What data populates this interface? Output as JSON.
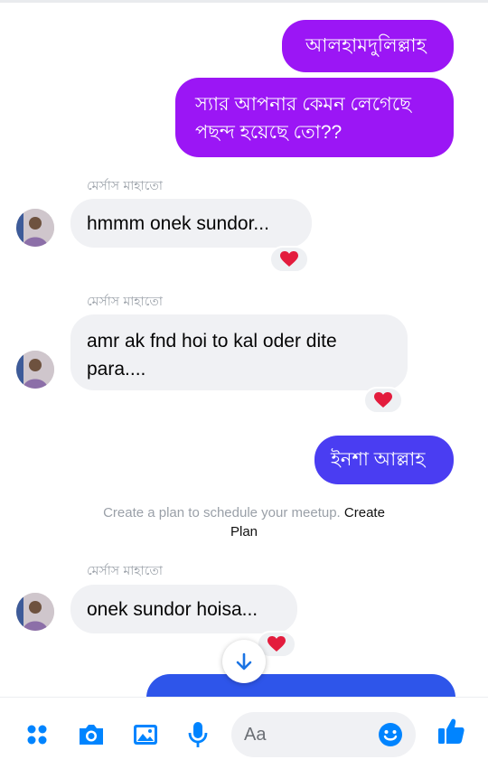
{
  "messages": {
    "out1": "আলহামদুলিল্লাহ",
    "out2_line1": "স্যার আপনার কেমন লেগেছে",
    "out2_line2": "পছন্দ হয়েছে তো??",
    "sender_name": "মের্সাস মাহাতো",
    "in1": "hmmm onek sundor...",
    "in2_line1": "amr ak fnd hoi to kal oder dite",
    "in2_line2": "para....",
    "out3": "ইনশা আল্লাহ",
    "in3": "onek sundor hoisa..."
  },
  "system": {
    "plan_text": "Create a plan to schedule your meetup.",
    "plan_link_1": "Create",
    "plan_link_2": "Plan"
  },
  "composer": {
    "placeholder": "Aa"
  },
  "colors": {
    "purple": "#9b16f5",
    "blue": "#4a3df2",
    "messenger_blue": "#0084ff",
    "heart": "#e31c3d"
  },
  "icons": [
    "menu-icon",
    "camera-icon",
    "image-icon",
    "microphone-icon",
    "emoji-icon",
    "like-icon",
    "heart-icon",
    "arrow-down-icon"
  ]
}
